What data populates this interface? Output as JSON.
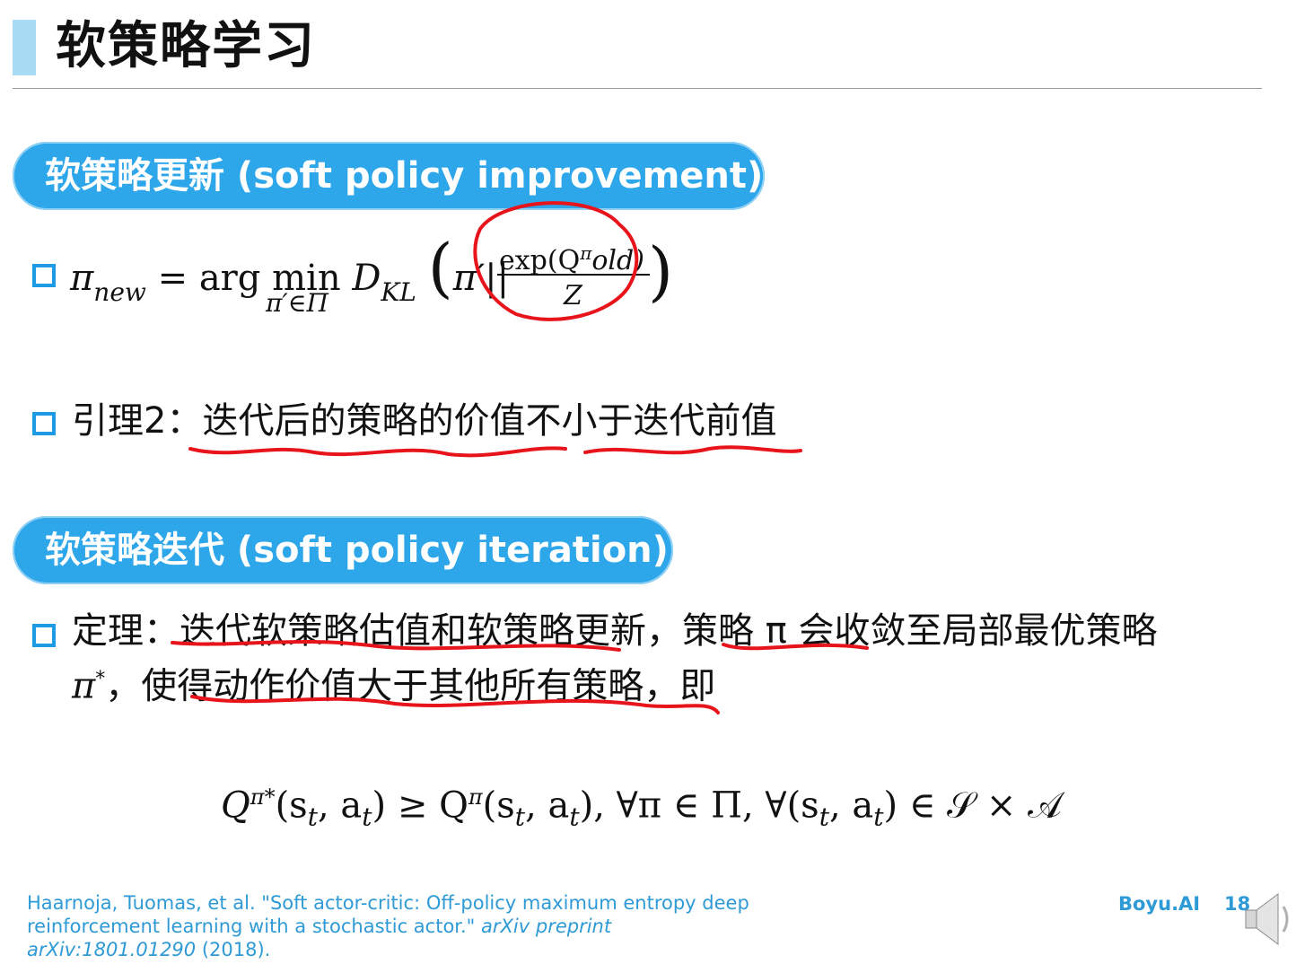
{
  "header": {
    "title": "软策略学习"
  },
  "section1": {
    "pill_label": "软策略更新 (soft policy improvement)",
    "formula": {
      "pi": "π",
      "new_sub": "new",
      "eq_argmin": " = arg min ",
      "under_min": "π′∈Π",
      "D": "D",
      "KL_sub": "KL",
      "pi_prime": "π′",
      "bars": "||",
      "numerator": "exp(Q",
      "numerator_sup": "π",
      "numerator_tail": "old)",
      "denominator": "Z"
    },
    "lemma_prefix": "引理2：",
    "lemma_text": "迭代后的策略的价值不小于迭代前值"
  },
  "section2": {
    "pill_label": "软策略迭代 (soft policy iteration)",
    "theorem_line1": "定理：迭代软策略估值和软策略更新，策略 π 会收敛至局部最优策略",
    "theorem_line2_pi": "π",
    "theorem_line2_sup": "*",
    "theorem_line2_text": "，使得动作价值大于其他所有策略，即",
    "inequality": {
      "Q": "Q",
      "sup1": "π",
      "sup1_star": "*",
      "args": "(s",
      "t": "t",
      "comma_a": ", a",
      "geq": ") ≥ Q",
      "sup2": "π",
      "args2": "(s",
      "forall": "), ∀π ∈ Π, ∀(s",
      "tail": ") ∈ 𝒮 × 𝒜"
    }
  },
  "footer": {
    "ref_line1": "Haarnoja, Tuomas, et al. \"Soft actor-critic: Off-policy maximum entropy deep",
    "ref_line2a": "reinforcement learning with a stochastic actor.\" ",
    "ref_line2b": "arXiv preprint",
    "ref_line3a": "arXiv:1801.01290",
    "ref_line3b": " (2018).",
    "brand": "Boyu.AI",
    "page": "18"
  },
  "colors": {
    "accent": "#2ea6ea",
    "ink": "#e8141c",
    "footer": "#2e9ad6"
  }
}
